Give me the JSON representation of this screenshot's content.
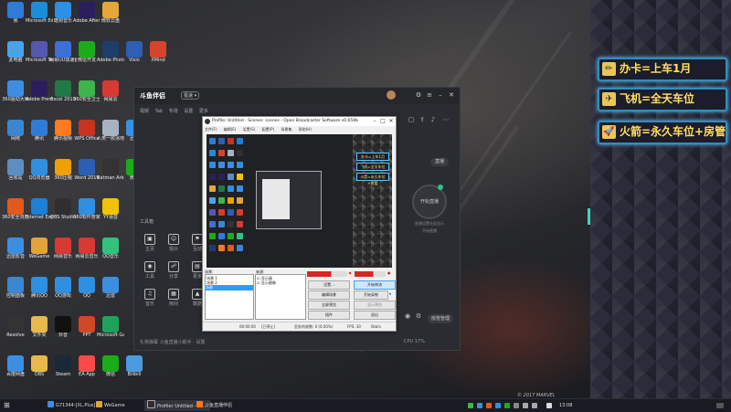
{
  "desktop": {
    "icons": [
      {
        "label": "我",
        "color": "#2f7bd8"
      },
      {
        "label": "Microsoft Edge",
        "color": "#1b8ed8"
      },
      {
        "label": "酷狗音乐",
        "color": "#2d8fe6"
      },
      {
        "label": "Adobe After Effects 2019",
        "color": "#2a1f5c"
      },
      {
        "label": "微软云盘",
        "color": "#e5a73a"
      },
      {
        "label": "此电脑",
        "color": "#4aa3e8"
      },
      {
        "label": "Microsoft Teams",
        "color": "#5558af"
      },
      {
        "label": "网易UU加速器",
        "color": "#3c6fd8"
      },
      {
        "label": "微信开发",
        "color": "#1aad19"
      },
      {
        "label": "Adobe Photosh...",
        "color": "#1d3d6b"
      },
      {
        "label": "Visio",
        "color": "#2d5fb5"
      },
      {
        "label": "XMind",
        "color": "#d9432e"
      },
      {
        "label": "360驱动大师",
        "color": "#3b8fe0"
      },
      {
        "label": "Adobe Premier...",
        "color": "#2a1f5c"
      },
      {
        "label": "Excel 2019",
        "color": "#1f7a45"
      },
      {
        "label": "360安全卫士",
        "color": "#3cb54a"
      },
      {
        "label": "网易云",
        "color": "#d73a32"
      },
      {
        "label": "网络",
        "color": "#3a86d2"
      },
      {
        "label": "腾讯",
        "color": "#2f7bd8"
      },
      {
        "label": "腾讯视频",
        "color": "#ff7a20"
      },
      {
        "label": "WPS Office",
        "color": "#c8331f"
      },
      {
        "label": "人类一败涂地 Human Fa...",
        "color": "#a8b3c2"
      },
      {
        "label": "迅雷",
        "color": "#3b8fe0"
      },
      {
        "label": "回收站",
        "color": "#5b8fc4"
      },
      {
        "label": "QQ浏览器",
        "color": "#2f8fe0"
      },
      {
        "label": "360压缩",
        "color": "#f0a000"
      },
      {
        "label": "Word 2019",
        "color": "#2b5fb5"
      },
      {
        "label": "Batman Arkham...",
        "color": "#333"
      },
      {
        "label": "微信",
        "color": "#1aad19"
      },
      {
        "label": "360安全浏览器",
        "color": "#e25a1b"
      },
      {
        "label": "Internet Explorer",
        "color": "#1d7fd6"
      },
      {
        "label": "OBS Studio",
        "color": "#302e31"
      },
      {
        "label": "360软件管家",
        "color": "#2f8fe0"
      },
      {
        "label": "YY语音",
        "color": "#f2c400"
      },
      {
        "label": "迅雷影音",
        "color": "#3b8fe0"
      },
      {
        "label": "WeGame",
        "color": "#e1a33a"
      },
      {
        "label": "网易音乐",
        "color": "#d73a32"
      },
      {
        "label": "网易云音乐",
        "color": "#d73a32"
      },
      {
        "label": "QQ音乐",
        "color": "#31c27c"
      },
      {
        "label": "控制面板",
        "color": "#3a86d2"
      },
      {
        "label": "腾讯QQ",
        "color": "#2f8fe0"
      },
      {
        "label": "QQ游戏",
        "color": "#2f8fe0"
      },
      {
        "label": "QQ",
        "color": "#2f8fe0"
      },
      {
        "label": "迅雷",
        "color": "#3b8fe0"
      },
      {
        "label": "Resolve",
        "color": "#333"
      },
      {
        "label": "文件夹",
        "color": "#e5b94a"
      },
      {
        "label": "抖音",
        "color": "#111"
      },
      {
        "label": "PPT",
        "color": "#d24726"
      },
      {
        "label": "Microsoft Gaming",
        "color": "#1fa35a"
      },
      {
        "label": "百度网盘",
        "color": "#3b8fe0"
      },
      {
        "label": "OBS",
        "color": "#e5b94a"
      },
      {
        "label": "Steam",
        "color": "#1b2838"
      },
      {
        "label": "EA App",
        "color": "#ff4747"
      },
      {
        "label": "微信",
        "color": "#1aad19"
      },
      {
        "label": "Bilibili",
        "color": "#4a9be0"
      }
    ]
  },
  "right_panel": {
    "items": [
      {
        "icon": "✏",
        "text": "办卡=上车1月"
      },
      {
        "icon": "✈",
        "text": "飞机=全天车位"
      },
      {
        "icon": "🚀",
        "text": "火箭=永久车位+房管"
      }
    ]
  },
  "douyu": {
    "logo": "斗鱼伴侣",
    "version": "极速 ▾",
    "tabs": [
      "视频",
      "Tab",
      "专场",
      "设置",
      "更多"
    ],
    "live_btn": "直播",
    "start_label": "开始直播",
    "hint1": "直播设置在此显示",
    "hint2": "开始直播",
    "side_items": [
      {
        "icon": "▣",
        "label": "主页"
      },
      {
        "icon": "☺",
        "label": "观众"
      },
      {
        "icon": "⚑",
        "label": "互动"
      },
      {
        "icon": "◉",
        "label": "工具"
      },
      {
        "icon": "☍",
        "label": "分享"
      },
      {
        "icon": "▤",
        "label": "更多"
      },
      {
        "icon": "♫",
        "label": "音乐"
      },
      {
        "icon": "▦",
        "label": "房间"
      },
      {
        "icon": "▲",
        "label": "数据"
      }
    ],
    "side_extra": "工具箱",
    "bottom_text": "礼物弹幕  斗鱼直播小助手  ·  设置",
    "mgr_btn": "房管管理",
    "cpu": "CPU 17%"
  },
  "obs": {
    "title": "Profile: Untitled - Scenes: scenes - Open Broadcaster Software v0.659b",
    "menu": [
      "文件(F)",
      "编辑(E)",
      "设置(S)",
      "配置(P)",
      "场景集",
      "帮助(H)"
    ],
    "scenes_label": "场景:",
    "scenes": [
      "场景 1",
      "场景 2",
      "场景"
    ],
    "sources_label": "来源:",
    "sources": [
      "显示器",
      "显示摄像"
    ],
    "buttons": {
      "settings": "设置...",
      "start": "开始串流",
      "edit_scene": "编辑场景",
      "start_rec": "开始录制",
      "fullscreen": "全屏预览",
      "preview": "显示预览",
      "plugins": "插件",
      "exit": "退出"
    },
    "status": {
      "time": "00:00:00",
      "state": "[已停止]",
      "frames": "丢失的帧数: 0 (0.00%)",
      "fps": "FPS: 30",
      "bitrate": "0kb/s"
    },
    "mini_panel": [
      "办卡=上车1月",
      "飞机=全天车位",
      "火箭=永久车位+房管"
    ]
  },
  "taskbar": {
    "items": [
      {
        "label": "G71344-[XL.Plus]",
        "color": "#3b8fe0"
      },
      {
        "label": "WeGame",
        "color": "#e1a33a"
      },
      {
        "label": "Profiler Untitled - Sc...",
        "color": "#302e31"
      },
      {
        "label": "斗鱼直播伴侣",
        "color": "#ff7a20"
      }
    ],
    "clock": "13:08",
    "watermark": "© 2017 MARVEL"
  }
}
